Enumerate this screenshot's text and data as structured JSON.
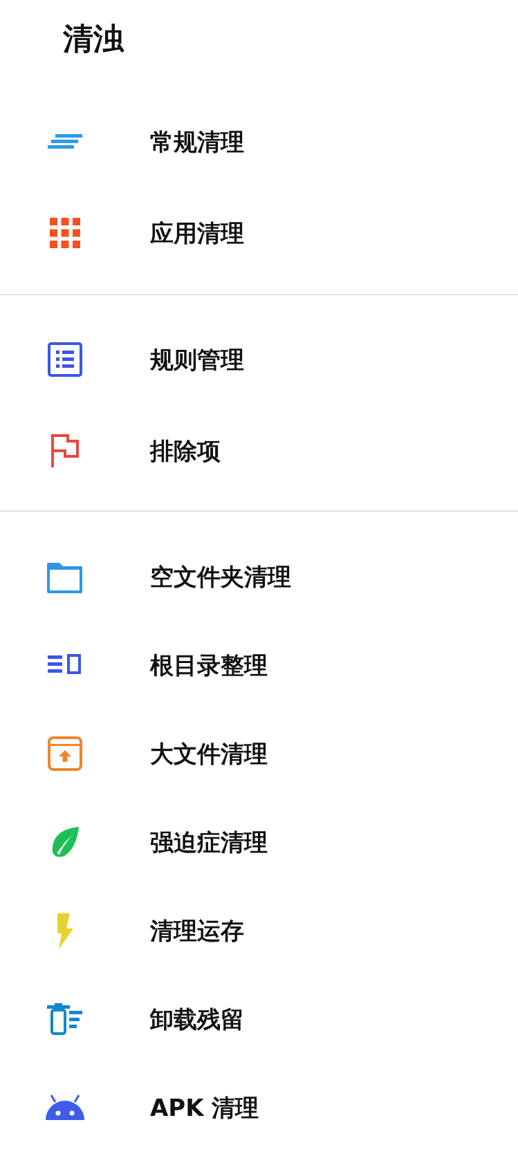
{
  "title": "清浊",
  "groups": [
    {
      "items": [
        {
          "label": "常规清理"
        },
        {
          "label": "应用清理"
        }
      ]
    },
    {
      "items": [
        {
          "label": "规则管理"
        },
        {
          "label": "排除项"
        }
      ]
    },
    {
      "items": [
        {
          "label": "空文件夹清理"
        },
        {
          "label": "根目录整理"
        },
        {
          "label": "大文件清理"
        },
        {
          "label": "强迫症清理"
        },
        {
          "label": "清理运存"
        },
        {
          "label": "卸载残留"
        },
        {
          "label": "APK 清理"
        }
      ]
    }
  ]
}
